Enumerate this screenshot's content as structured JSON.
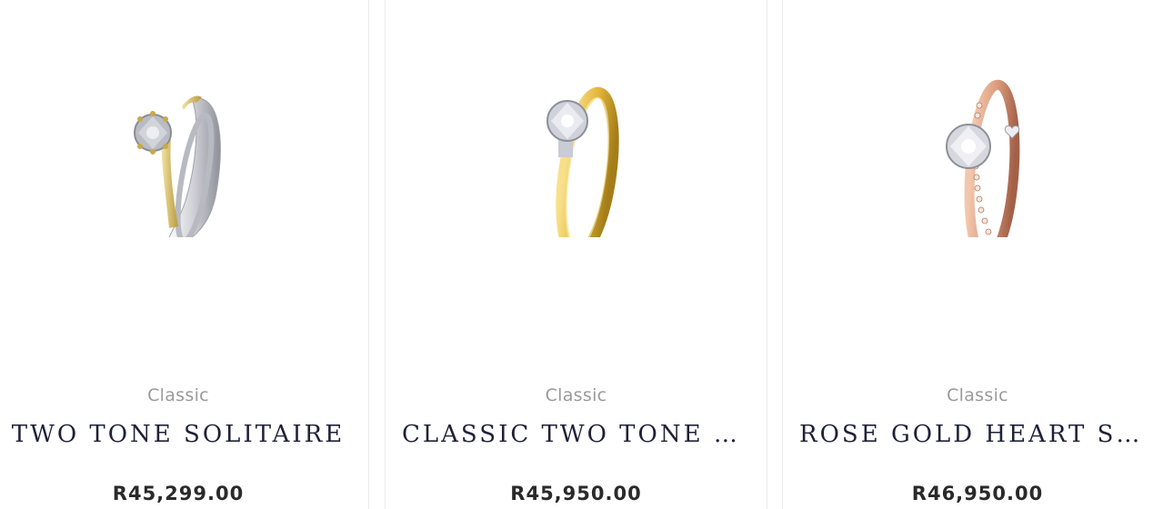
{
  "products": [
    {
      "category": "Classic",
      "name": "TWO TONE SOLITAIRE",
      "price": "R45,299.00",
      "image_icon": "two-tone-solitaire-ring-icon",
      "metal_colors": [
        "#d9c27a",
        "#e6e6ea"
      ]
    },
    {
      "category": "Classic",
      "name": "CLASSIC TWO TONE SOLITAIRE",
      "price": "R45,950.00",
      "image_icon": "yellow-gold-solitaire-ring-icon",
      "metal_colors": [
        "#e2b53a",
        "#c9ccd4"
      ]
    },
    {
      "category": "Classic",
      "name": "ROSE GOLD HEART SOLITAIRE",
      "price": "R46,950.00",
      "image_icon": "rose-gold-solitaire-ring-icon",
      "metal_colors": [
        "#d99a7a",
        "#e8e8ee"
      ]
    }
  ]
}
